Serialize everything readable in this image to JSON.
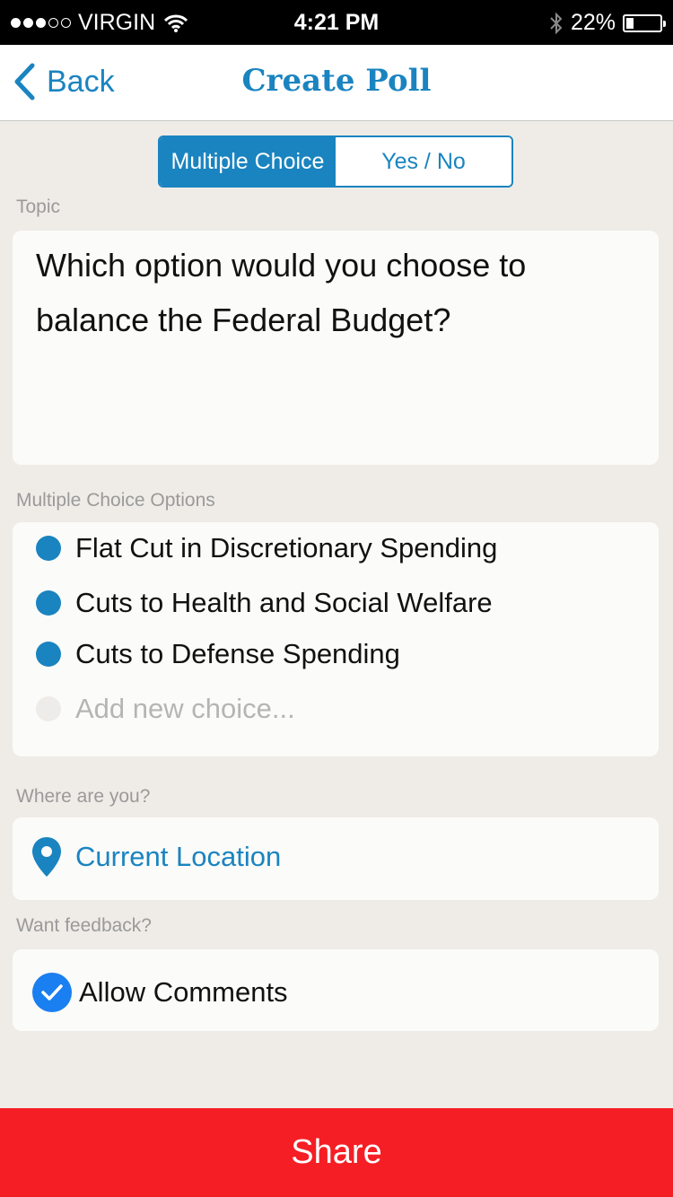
{
  "status_bar": {
    "carrier": "VIRGIN",
    "time": "4:21 PM",
    "battery_percent": "22%",
    "battery_level": 0.22,
    "signal_bars_filled": 3,
    "signal_bars_total": 5
  },
  "nav": {
    "back_label": "Back",
    "title": "Create Poll"
  },
  "segments": {
    "multiple_choice": "Multiple Choice",
    "yes_no": "Yes / No",
    "selected": "Multiple Choice"
  },
  "topic": {
    "label": "Topic",
    "text": "Which option would you choose to balance the Federal Budget?"
  },
  "options": {
    "label": "Multiple Choice Options",
    "items": [
      "Flat Cut in Discretionary Spending",
      "Cuts to Health and Social Welfare",
      "Cuts to Defense Spending"
    ],
    "add_placeholder": "Add new choice..."
  },
  "location": {
    "label": "Where are you?",
    "value": "Current Location"
  },
  "feedback": {
    "label": "Want feedback?",
    "allow_comments": "Allow Comments",
    "checked": true
  },
  "share_label": "Share",
  "colors": {
    "accent": "#1a84c0",
    "share": "#f51e24",
    "background": "#efece7",
    "checkbox": "#1a7ff0"
  },
  "icons": {
    "back": "chevron-left-icon",
    "wifi": "wifi-icon",
    "bluetooth": "bluetooth-icon",
    "battery": "battery-icon",
    "location": "location-pin-icon",
    "check": "checkmark-icon"
  }
}
